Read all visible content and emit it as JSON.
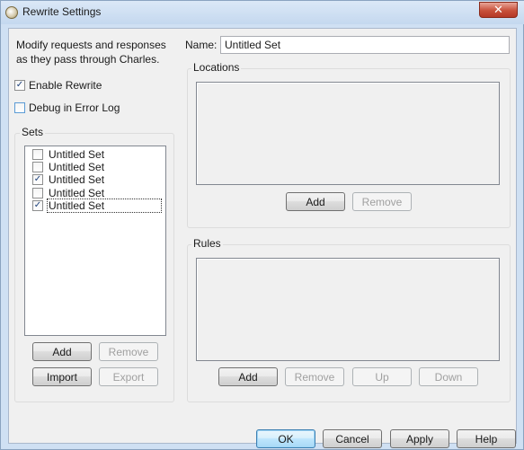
{
  "window": {
    "title": "Rewrite Settings",
    "close_glyph": "✕"
  },
  "intro": {
    "line1": "Modify requests and responses",
    "line2": "as they pass through Charles."
  },
  "enable_rewrite": {
    "label": "Enable Rewrite",
    "checked": true
  },
  "debug_log": {
    "label": "Debug in Error Log",
    "checked": false
  },
  "sets": {
    "label": "Sets",
    "items": [
      {
        "label": "Untitled Set",
        "checked": false
      },
      {
        "label": "Untitled Set",
        "checked": false
      },
      {
        "label": "Untitled Set",
        "checked": true
      },
      {
        "label": "Untitled Set",
        "checked": false
      },
      {
        "label": "Untitled Set",
        "checked": true
      }
    ],
    "add_label": "Add",
    "remove_label": "Remove",
    "import_label": "Import",
    "export_label": "Export"
  },
  "name": {
    "label": "Name:",
    "value": "Untitled Set"
  },
  "locations": {
    "label": "Locations",
    "add_label": "Add",
    "remove_label": "Remove"
  },
  "rules": {
    "label": "Rules",
    "add_label": "Add",
    "remove_label": "Remove",
    "up_label": "Up",
    "down_label": "Down"
  },
  "footer": {
    "ok_label": "OK",
    "cancel_label": "Cancel",
    "apply_label": "Apply",
    "help_label": "Help"
  },
  "check_glyph": "✓"
}
